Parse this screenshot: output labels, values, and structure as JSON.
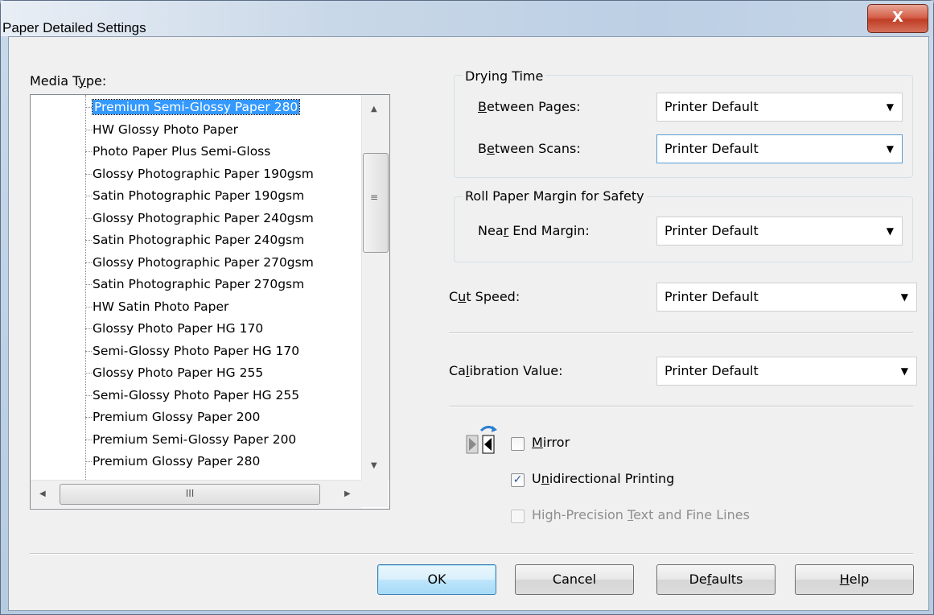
{
  "window": {
    "title": "Paper Detailed Settings",
    "close_label": "X"
  },
  "media_type": {
    "label_pre": "Media T",
    "label_ul": "y",
    "label_post": "pe:",
    "items": [
      "Premium Semi-Glossy Paper 280",
      "HW Glossy Photo Paper",
      "Photo Paper Plus Semi-Gloss",
      "Glossy Photographic Paper 190gsm",
      "Satin Photographic Paper 190gsm",
      "Glossy Photographic Paper 240gsm",
      "Satin Photographic Paper 240gsm",
      "Glossy Photographic Paper 270gsm",
      "Satin Photographic Paper 270gsm",
      "HW Satin Photo Paper",
      "Glossy Photo Paper HG 170",
      "Semi-Glossy Photo Paper HG 170",
      "Glossy Photo Paper HG 255",
      "Semi-Glossy Photo Paper HG 255",
      "Premium Glossy Paper 200",
      "Premium Semi-Glossy Paper 200",
      "Premium Glossy Paper 280"
    ],
    "selected_index": 0,
    "hscroll_grip": "III"
  },
  "drying_time": {
    "group_label": "Drying Time",
    "between_pages": {
      "pre": "",
      "ul": "B",
      "post": "etween Pages:",
      "value": "Printer Default"
    },
    "between_scans": {
      "pre": "B",
      "ul": "e",
      "post": "tween Scans:",
      "value": "Printer Default"
    }
  },
  "roll_margin": {
    "group_label": "Roll Paper Margin for Safety",
    "near_end": {
      "pre": "Nea",
      "ul": "r",
      "post": " End Margin:",
      "value": "Printer Default"
    }
  },
  "cut_speed": {
    "pre": "C",
    "ul": "u",
    "post": "t Speed:",
    "value": "Printer Default"
  },
  "calibration": {
    "pre": "Ca",
    "ul": "l",
    "post": "ibration Value:",
    "value": "Printer Default"
  },
  "mirror": {
    "pre": "",
    "ul": "M",
    "post": "irror",
    "checked": false
  },
  "unidirectional": {
    "pre": "U",
    "ul": "n",
    "post": "idirectional Printing",
    "checked": true
  },
  "high_precision": {
    "pre": "High-Precision ",
    "ul": "T",
    "post": "ext and Fine Lines",
    "checked": false,
    "enabled": false
  },
  "buttons": {
    "ok": "OK",
    "cancel": "Cancel",
    "defaults": {
      "pre": "De",
      "ul": "f",
      "post": "aults"
    },
    "help": {
      "pre": "",
      "ul": "H",
      "post": "elp"
    }
  },
  "icons": {
    "mirror": "mirror-flip-icon",
    "dropdown": "chevron-down-icon",
    "check": "checkmark-icon"
  },
  "colors": {
    "selection": "#3399ff",
    "dialog_bg": "#f0f0f0",
    "close_button": "#c8452c"
  }
}
